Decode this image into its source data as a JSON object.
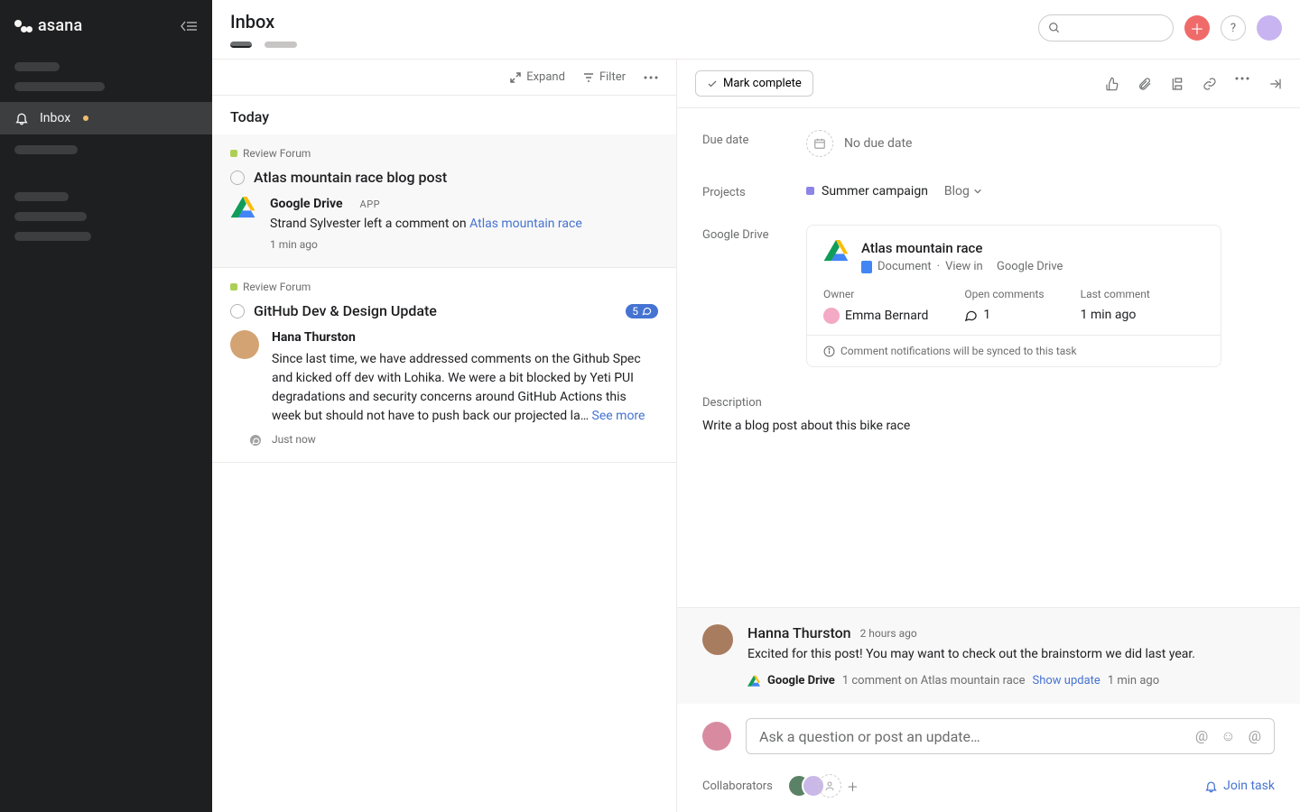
{
  "brand": "asana",
  "sidebar": {
    "inbox_label": "Inbox"
  },
  "header": {
    "title": "Inbox"
  },
  "inbox_toolbar": {
    "expand": "Expand",
    "filter": "Filter"
  },
  "inbox": {
    "section": "Today",
    "items": [
      {
        "project": "Review Forum",
        "title": "Atlas mountain race blog post",
        "source": "Google Drive",
        "source_badge": "APP",
        "text_prefix": "Strand Sylvester left a comment on ",
        "text_link": "Atlas mountain race",
        "time": "1 min ago"
      },
      {
        "project": "Review Forum",
        "title": "GitHub Dev & Design Update",
        "badge_count": "5",
        "author": "Hana Thurston",
        "text": "Since last time, we have addressed comments on the Github Spec and kicked off dev with Lohika. We were a bit blocked by Yeti PUI degradations and security concerns around GitHub Actions this week but should not have to push back our projected la… ",
        "see_more": "See more",
        "time": "Just now"
      }
    ]
  },
  "detail_toolbar": {
    "mark_complete": "Mark complete"
  },
  "detail": {
    "due_label": "Due date",
    "due_value": "No due date",
    "projects_label": "Projects",
    "project_name": "Summer campaign",
    "project_section": "Blog",
    "gd_label": "Google Drive",
    "gd_card": {
      "title": "Atlas mountain race",
      "subtype": "Document",
      "view_in": "View in",
      "view_target": "Google Drive",
      "owner_label": "Owner",
      "owner": "Emma Bernard",
      "open_label": "Open comments",
      "open_count": "1",
      "last_label": "Last comment",
      "last_value": "1 min ago",
      "sync_note": "Comment notifications will be synced to this task"
    },
    "desc_label": "Description",
    "desc_text": "Write a blog post about this bike race"
  },
  "comment": {
    "author": "Hanna Thurston",
    "time": "2 hours ago",
    "text": "Excited for this post! You may want to check out the brainstorm we did last year.",
    "update_source": "Google Drive",
    "update_text": "1 comment on Atlas mountain race",
    "update_link": "Show update",
    "update_time": "1 min ago"
  },
  "compose": {
    "placeholder": "Ask a question or post an update…"
  },
  "footer": {
    "collab_label": "Collaborators",
    "join": "Join task"
  }
}
